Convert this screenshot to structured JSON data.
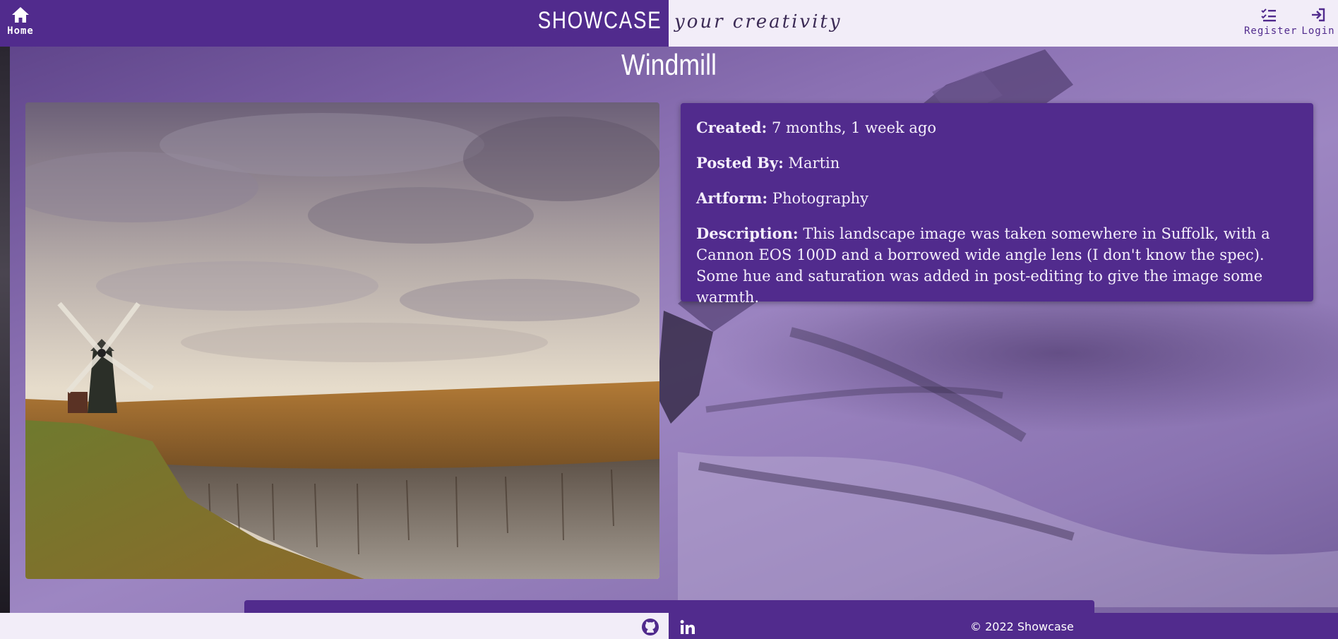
{
  "header": {
    "home_label": "Home",
    "brand": "SHOWCASE",
    "tagline": "your creativity",
    "register_label": "Register",
    "login_label": "Login"
  },
  "post": {
    "title": "Windmill",
    "created_key": "Created:",
    "created_value": "7 months, 1 week ago",
    "posted_by_key": "Posted By:",
    "posted_by_value": "Martin",
    "artform_key": "Artform:",
    "artform_value": "Photography",
    "description_key": "Description:",
    "description_value": "This landscape image was taken somewhere in Suffolk, with a Cannon EOS 100D and a borrowed wide angle lens (I don't know the spec). Some hue and saturation was added in post-editing to give the image some warmth."
  },
  "footer": {
    "copyright": "© 2022 Showcase",
    "icons": [
      "github-icon",
      "linkedin-icon"
    ]
  },
  "colors": {
    "brand_purple": "#512b8d",
    "header_light": "#f2edf8"
  }
}
